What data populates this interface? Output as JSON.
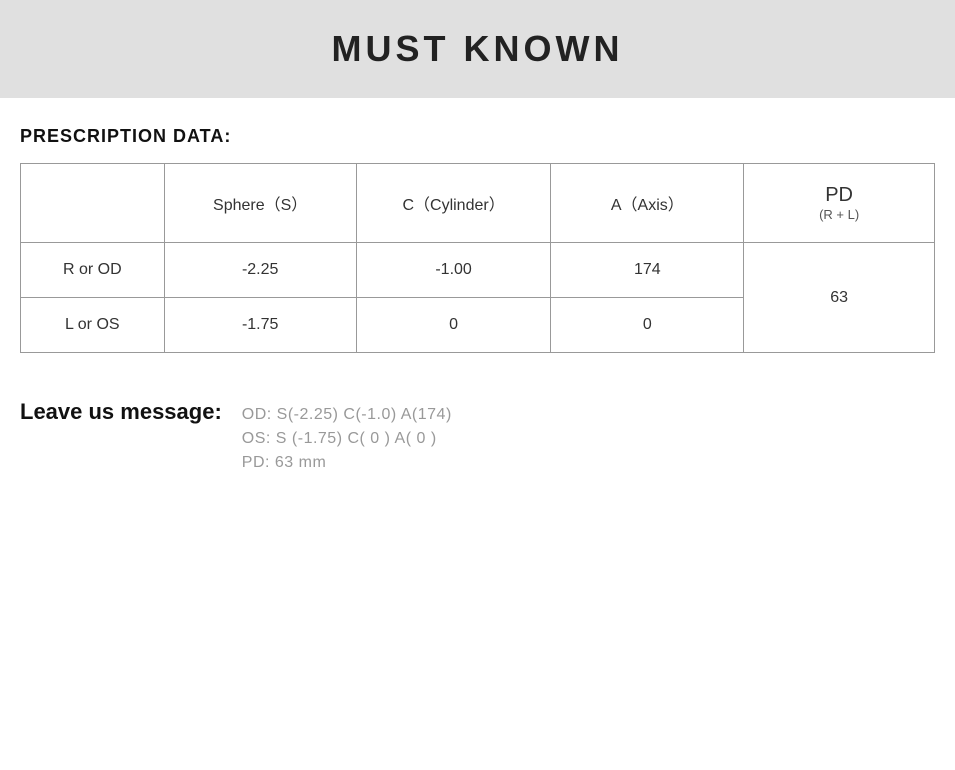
{
  "header": {
    "title": "MUST KNOWN"
  },
  "prescription": {
    "section_label": "PRESCRIPTION DATA:",
    "columns": {
      "empty": "",
      "sphere": "Sphere（S）",
      "cylinder": "C（Cylinder）",
      "axis": "A（Axis）",
      "pd_main": "PD",
      "pd_sub": "(R + L)"
    },
    "rows": [
      {
        "label": "R or OD",
        "sphere": "-2.25",
        "cylinder": "-1.00",
        "axis": "174",
        "pd": ""
      },
      {
        "label": "L or OS",
        "sphere": "-1.75",
        "cylinder": "0",
        "axis": "0",
        "pd": "63"
      }
    ]
  },
  "message": {
    "label": "Leave us message:",
    "lines": [
      "OD:  S(-2.25)    C(-1.0)   A(174)",
      "OS:  S (-1.75)    C( 0 )    A( 0 )",
      "PD:  63 mm"
    ]
  }
}
